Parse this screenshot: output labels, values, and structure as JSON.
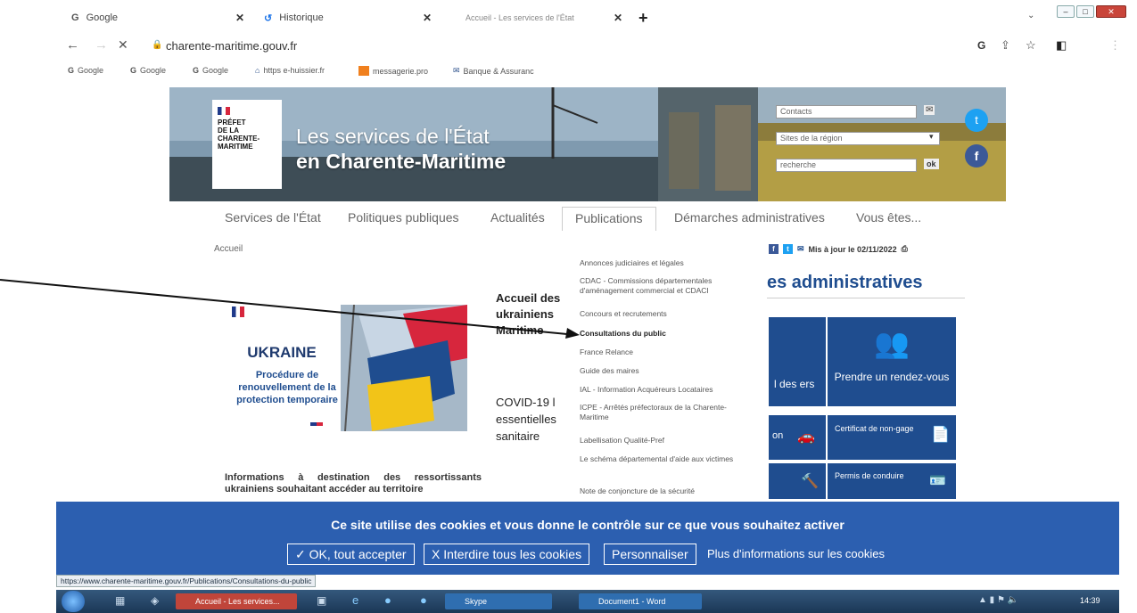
{
  "tabs": [
    {
      "title": "Google",
      "icon": "G"
    },
    {
      "title": "Historique",
      "icon": "history"
    },
    {
      "title": "Accueil - Les services de l'État",
      "icon": "blank"
    }
  ],
  "tab_close": "✕",
  "new_tab": "+",
  "address": {
    "url": "charente-maritime.gouv.fr"
  },
  "bookmarks": [
    "Google",
    "Google",
    "Google",
    "https e-huissier.fr",
    "messagerie.pro",
    "Banque & Assuranc"
  ],
  "site": {
    "logo": [
      "PRÉFET",
      "DE LA",
      "CHARENTE-",
      "MARITIME"
    ],
    "title_line1": "Les services de l'État",
    "title_line2": "en Charente-Maritime",
    "contacts_placeholder": "Contacts",
    "sites_region": "Sites de la région",
    "search_placeholder": "recherche",
    "ok": "ok",
    "nav": [
      "Services de l'État",
      "Politiques publiques",
      "Actualités",
      "Publications",
      "Démarches administratives",
      "Vous êtes..."
    ],
    "breadcrumb": "Accueil",
    "updated": "Mis à jour le 02/11/2022",
    "section_heading": "es administratives",
    "ukraine": {
      "title": "UKRAINE",
      "subtitle": "Procédure de renouvellement de la protection temporaire",
      "caption": "Informations à destination des ressortissants ukrainiens souhaitant accéder au territoire"
    },
    "news1": "Accueil des ukrainiens Maritime",
    "news2": "COVID-19 l essentielles sanitaire",
    "dropdown": [
      "Annonces judiciaires et légales",
      "CDAC - Commissions départementales d'aménagement commercial et CDACI",
      "Concours et recrutements",
      "Consultations du public",
      "France Relance",
      "Guide des maires",
      "IAL - Information Acquéreurs Locataires",
      "ICPE - Arrêtés préfectoraux de la Charente-Maritime",
      "Labellisation Qualité-Pref",
      "Le schéma départemental d'aide aux victimes",
      "Note de conjoncture de la sécurité"
    ],
    "cards": {
      "c1": "l des ers",
      "c2": "Prendre un rendez-vous",
      "c3": "Certificat de non-gage",
      "c4": "Permis de conduire",
      "c5": "on"
    }
  },
  "cookie": {
    "message": "Ce site utilise des cookies et vous donne le contrôle sur ce que vous souhaitez activer",
    "accept": "✓ OK, tout accepter",
    "deny": "X Interdire tous les cookies",
    "custom": "Personnaliser",
    "more": "Plus d'informations sur les cookies"
  },
  "status_url": "https://www.charente-maritime.gouv.fr/Publications/Consultations-du-public",
  "taskbar": {
    "items": [
      "Accueil - Les services...",
      "Skype",
      "Document1 - Word"
    ],
    "clock": "14:39"
  },
  "colors": {
    "accent": "#1f4d8f",
    "cookie_bg": "#2c5fb0",
    "heading": "#1f4d8f"
  }
}
